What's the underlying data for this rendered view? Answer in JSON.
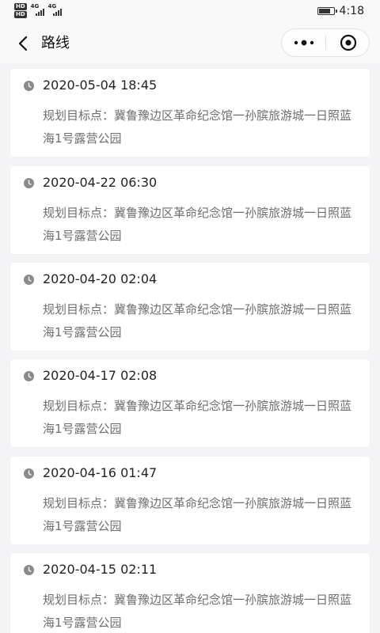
{
  "status_bar": {
    "hd_badges": [
      "HD",
      "HD"
    ],
    "net_labels": [
      "4G",
      "4G"
    ],
    "time": "4:18",
    "battery_level": 0.8
  },
  "nav": {
    "back_icon": "chevron-left-icon",
    "title": "路线",
    "more_icon": "more-dots-icon",
    "close_icon": "target-circle-icon"
  },
  "routes": [
    {
      "time": "2020-05-04 18:45",
      "desc": "规划目标点：冀鲁豫边区革命纪念馆一孙膑旅游城一日照蓝海1号露营公园"
    },
    {
      "time": "2020-04-22 06:30",
      "desc": "规划目标点：冀鲁豫边区革命纪念馆一孙膑旅游城一日照蓝海1号露营公园"
    },
    {
      "time": "2020-04-20 02:04",
      "desc": "规划目标点：冀鲁豫边区革命纪念馆一孙膑旅游城一日照蓝海1号露营公园"
    },
    {
      "time": "2020-04-17 02:08",
      "desc": "规划目标点：冀鲁豫边区革命纪念馆一孙膑旅游城一日照蓝海1号露营公园"
    },
    {
      "time": "2020-04-16 01:47",
      "desc": "规划目标点：冀鲁豫边区革命纪念馆一孙膑旅游城一日照蓝海1号露营公园"
    },
    {
      "time": "2020-04-15 02:11",
      "desc": "规划目标点：冀鲁豫边区革命纪念馆一孙膑旅游城一日照蓝海1号露营公园"
    }
  ],
  "colors": {
    "background": "#f4f4f6",
    "card": "#ffffff",
    "clock_icon": "#8a8a8a",
    "desc_text": "#6e6e6e"
  }
}
